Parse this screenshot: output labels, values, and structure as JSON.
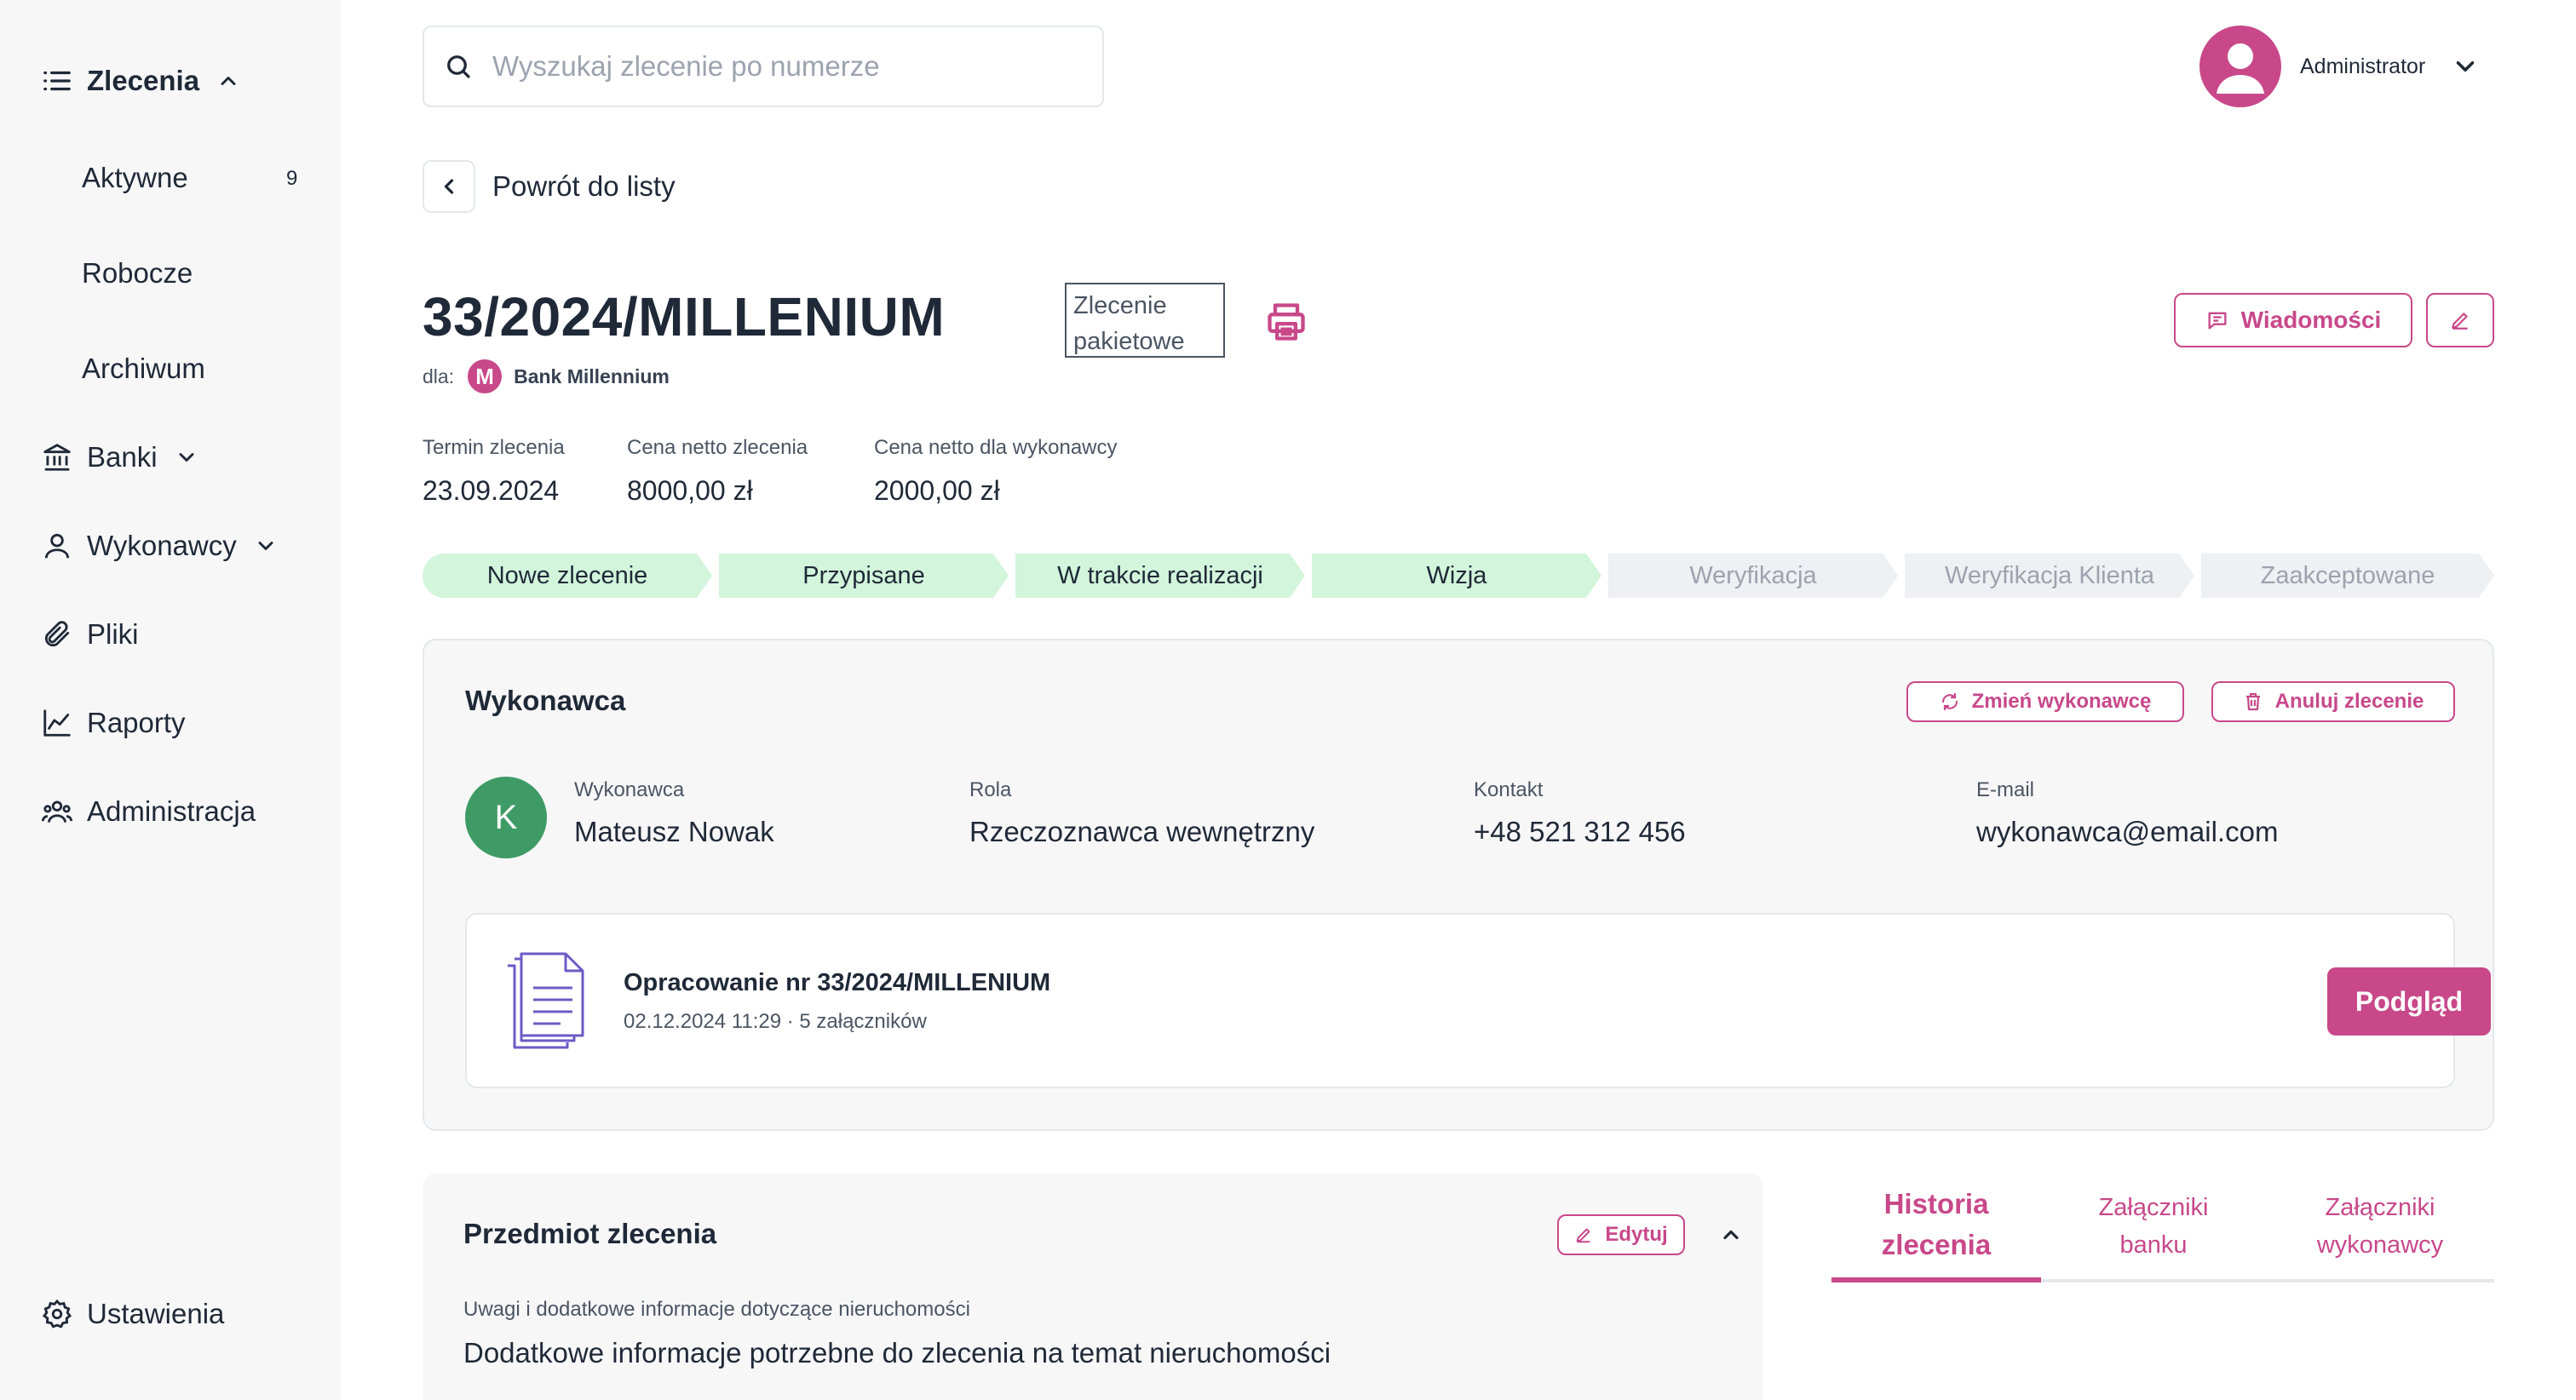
{
  "sidebar": {
    "orders_label": "Zlecenia",
    "sub_items": [
      {
        "label": "Aktywne",
        "count": "9"
      },
      {
        "label": "Robocze"
      },
      {
        "label": "Archiwum"
      }
    ],
    "banks_label": "Banki",
    "contractors_label": "Wykonawcy",
    "files_label": "Pliki",
    "reports_label": "Raporty",
    "admin_label": "Administracja",
    "settings_label": "Ustawienia"
  },
  "search": {
    "placeholder": "Wyszukaj zlecenie po numerze"
  },
  "user": {
    "name": "Administrator"
  },
  "back_label": "Powrót do listy",
  "order": {
    "number": "33/2024/MILLENIUM",
    "for_label": "dla:",
    "bank_initial": "M",
    "bank_name": "Bank Millennium",
    "packet_label": "Zlecenie pakietowe",
    "messages_label": "Wiadomości",
    "deadline_label": "Termin zlecenia",
    "deadline_value": "23.09.2024",
    "net_price_label": "Cena netto zlecenia",
    "net_price_value": "8000,00 zł",
    "contractor_price_label": "Cena netto dla wykonawcy",
    "contractor_price_value": "2000,00 zł"
  },
  "steps": [
    {
      "label": "Nowe zlecenie",
      "done": true
    },
    {
      "label": "Przypisane",
      "done": true
    },
    {
      "label": "W trakcie realizacji",
      "done": true
    },
    {
      "label": "Wizja",
      "done": true
    },
    {
      "label": "Weryfikacja",
      "done": false
    },
    {
      "label": "Weryfikacja Klienta",
      "done": false
    },
    {
      "label": "Zaakceptowane",
      "done": false
    }
  ],
  "performer": {
    "section_title": "Wykonawca",
    "change_label": "Zmień wykonawcę",
    "cancel_label": "Anuluj zlecenie",
    "initial": "K",
    "name_label": "Wykonawca",
    "name": "Mateusz Nowak",
    "role_label": "Rola",
    "role": "Rzeczoznawca wewnętrzny",
    "contact_label": "Kontakt",
    "contact": "+48 521 312 456",
    "email_label": "E-mail",
    "email": "wykonawca@email.com"
  },
  "document": {
    "title": "Opracowanie nr 33/2024/MILLENIUM",
    "subtitle": "02.12.2024 11:29 · 5 załączników",
    "preview_label": "Podgląd"
  },
  "subject": {
    "title": "Przedmiot zlecenia",
    "edit_label": "Edytuj",
    "notes_label": "Uwagi i dodatkowe informacje dotyczące nieruchomości",
    "notes_value": "Dodatkowe informacje potrzebne do zlecenia na temat nieruchomości"
  },
  "tabs": [
    {
      "line1": "Historia",
      "line2": "zlecenia"
    },
    {
      "line1": "Załączniki",
      "line2": "banku"
    },
    {
      "line1": "Załączniki",
      "line2": "wykonawcy"
    }
  ],
  "colors": {
    "accent": "#c8488a",
    "done_step": "#d3f5dc",
    "todo_step": "#eef0f3",
    "performer_avatar": "#3f9b65"
  }
}
